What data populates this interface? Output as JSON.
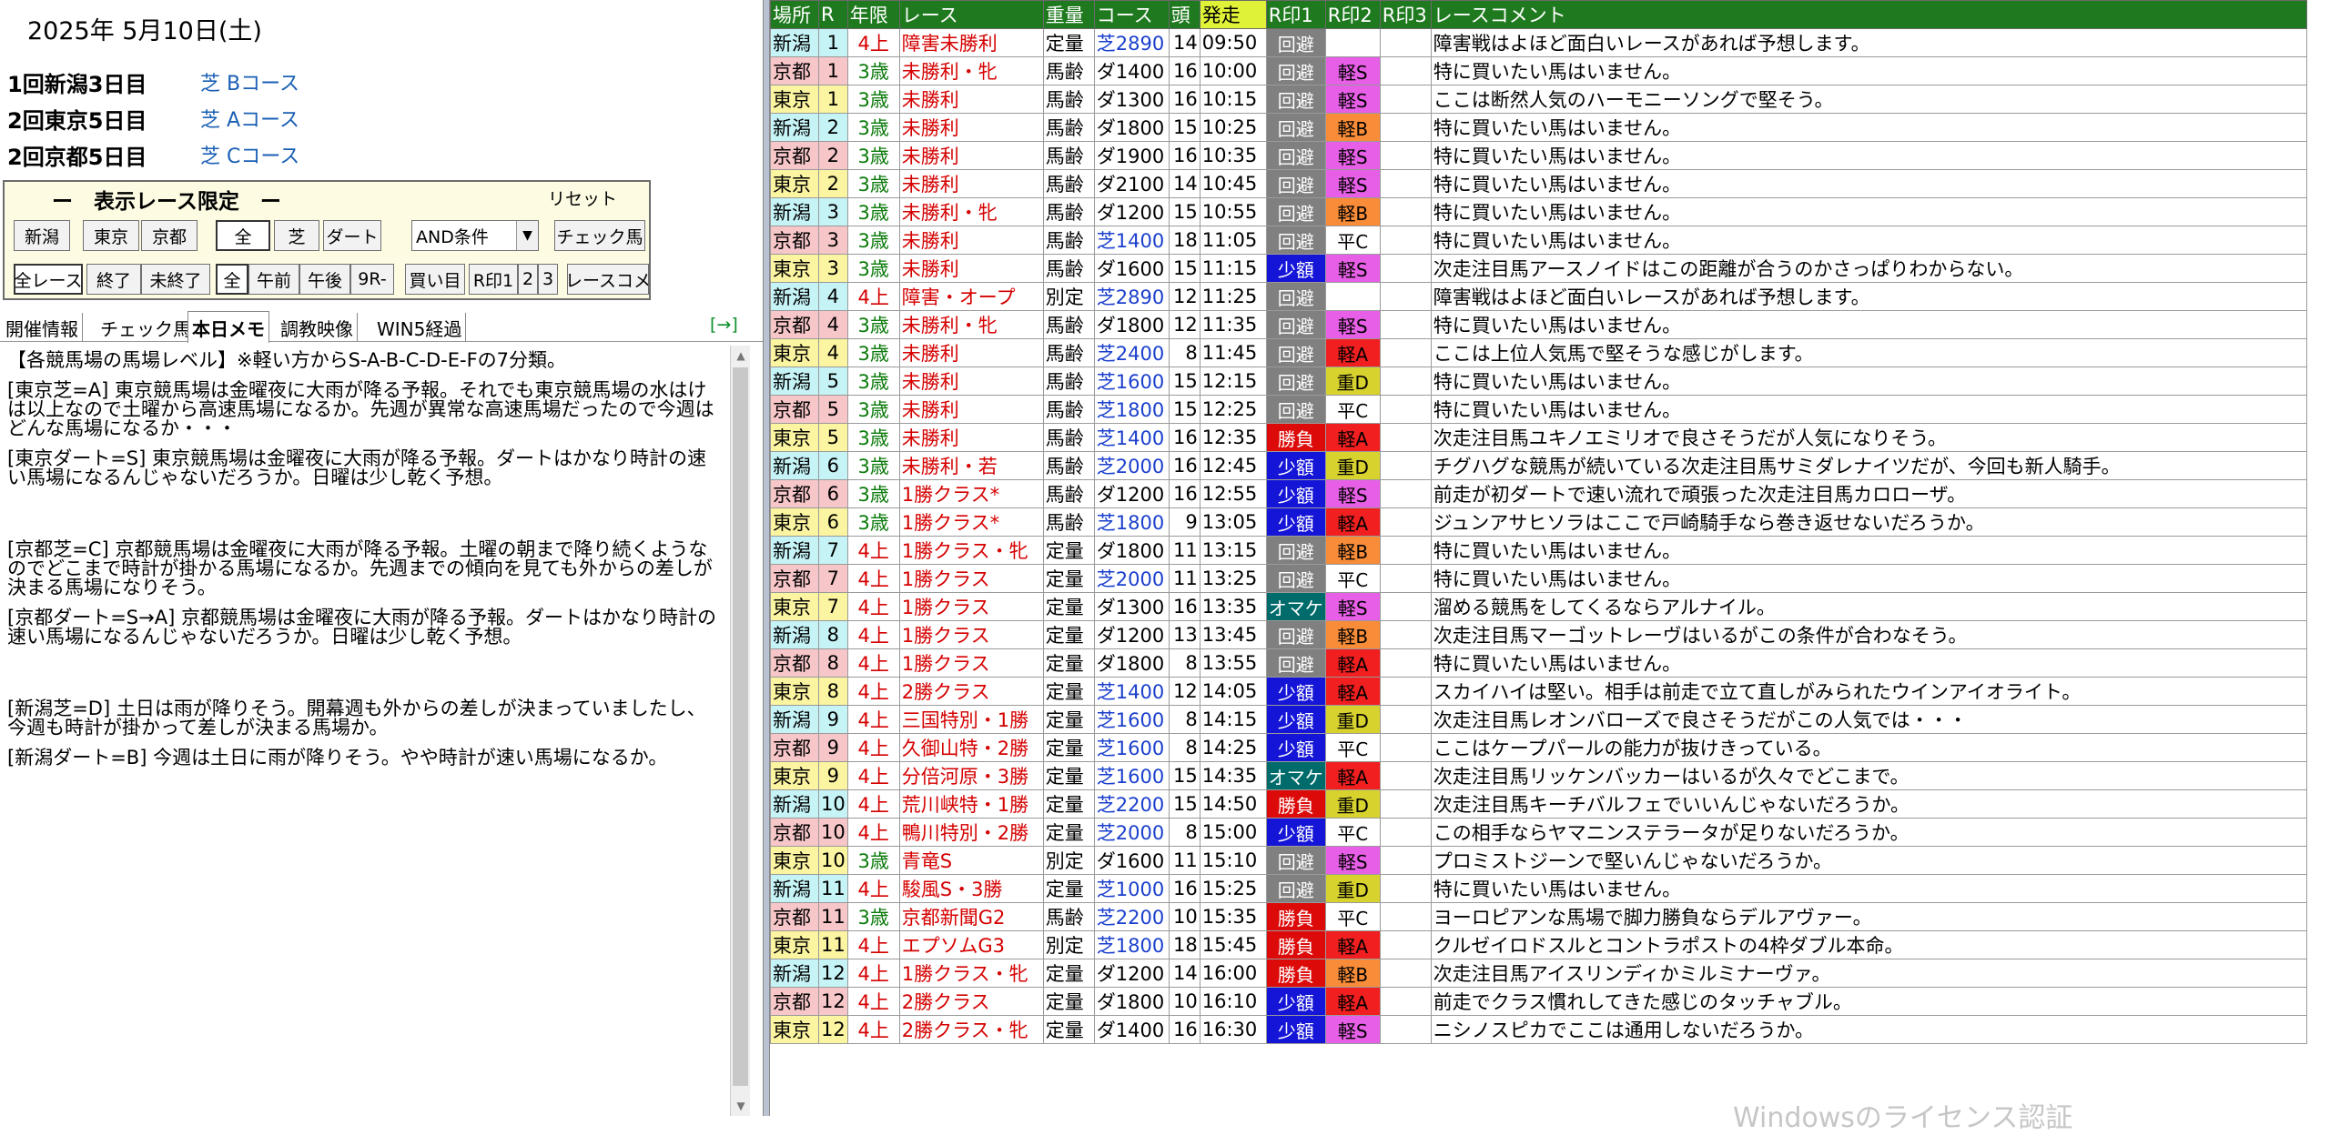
{
  "left": {
    "date": "2025年 5月10日(土)",
    "meets": [
      {
        "name": "1回新潟3日目",
        "course": "芝 Bコース"
      },
      {
        "name": "2回東京5日目",
        "course": "芝 Aコース"
      },
      {
        "name": "2回京都5日目",
        "course": "芝 Cコース"
      }
    ],
    "filter": {
      "title": "ー　表示レース限定　ー",
      "reset": "リセット",
      "row1": [
        "新潟",
        "東京",
        "京都",
        "全",
        "芝",
        "ダート"
      ],
      "and_select": "AND条件",
      "check_horse": "チェック馬",
      "row2": [
        "全レース",
        "終了",
        "未終了",
        "全",
        "午前",
        "午後",
        "9R-",
        "買い目",
        "R印1",
        "2",
        "3",
        "レースコメ"
      ]
    },
    "tabs": [
      "開催情報",
      "チェック馬",
      "本日メモ",
      "調教映像",
      "WIN5経過"
    ],
    "tab_arrow": "[→]",
    "memo": [
      "【各競馬場の馬場レベル】※軽い方からS-A-B-C-D-E-Fの7分類。",
      "[東京芝=A] 東京競馬場は金曜夜に大雨が降る予報。それでも東京競馬場の水はけは以上なので土曜から高速馬場になるか。先週が異常な高速馬場だったので今週はどんな馬場になるか・・・",
      "[東京ダート=S] 東京競馬場は金曜夜に大雨が降る予報。ダートはかなり時計の速い馬場になるんじゃないだろうか。日曜は少し乾く予想。",
      "",
      "[京都芝=C] 京都競馬場は金曜夜に大雨が降る予報。土曜の朝まで降り続くようなのでどこまで時計が掛かる馬場になるか。先週までの傾向を見ても外からの差しが決まる馬場になりそう。",
      "[京都ダート=S→A] 京都競馬場は金曜夜に大雨が降る予報。ダートはかなり時計の速い馬場になるんじゃないだろうか。日曜は少し乾く予想。",
      "",
      "[新潟芝=D] 土日は雨が降りそう。開幕週も外からの差しが決まっていましたし、今週も時計が掛かって差しが決まる馬場か。",
      "[新潟ダート=B] 今週は土日に雨が降りそう。やや時計が速い馬場になるか。"
    ]
  },
  "grid": {
    "headers": [
      "場所",
      "R",
      "年限",
      "レース",
      "重量",
      "コース",
      "頭",
      "発走",
      "R印1",
      "R印2",
      "R印3",
      "レースコメント"
    ],
    "rows": [
      [
        "新潟",
        "1",
        "4上",
        "障害未勝利",
        "定量",
        "芝2890",
        "14",
        "09:50",
        "回避",
        "",
        "",
        "障害戦はよほど面白いレースがあれば予想します。"
      ],
      [
        "京都",
        "1",
        "3歳",
        "未勝利・牝",
        "馬齢",
        "ダ1400",
        "16",
        "10:00",
        "回避",
        "軽S",
        "",
        "特に買いたい馬はいません。"
      ],
      [
        "東京",
        "1",
        "3歳",
        "未勝利",
        "馬齢",
        "ダ1300",
        "16",
        "10:15",
        "回避",
        "軽S",
        "",
        "ここは断然人気のハーモニーソングで堅そう。"
      ],
      [
        "新潟",
        "2",
        "3歳",
        "未勝利",
        "馬齢",
        "ダ1800",
        "15",
        "10:25",
        "回避",
        "軽B",
        "",
        "特に買いたい馬はいません。"
      ],
      [
        "京都",
        "2",
        "3歳",
        "未勝利",
        "馬齢",
        "ダ1900",
        "16",
        "10:35",
        "回避",
        "軽S",
        "",
        "特に買いたい馬はいません。"
      ],
      [
        "東京",
        "2",
        "3歳",
        "未勝利",
        "馬齢",
        "ダ2100",
        "14",
        "10:45",
        "回避",
        "軽S",
        "",
        "特に買いたい馬はいません。"
      ],
      [
        "新潟",
        "3",
        "3歳",
        "未勝利・牝",
        "馬齢",
        "ダ1200",
        "15",
        "10:55",
        "回避",
        "軽B",
        "",
        "特に買いたい馬はいません。"
      ],
      [
        "京都",
        "3",
        "3歳",
        "未勝利",
        "馬齢",
        "芝1400",
        "18",
        "11:05",
        "回避",
        "平C",
        "",
        "特に買いたい馬はいません。"
      ],
      [
        "東京",
        "3",
        "3歳",
        "未勝利",
        "馬齢",
        "ダ1600",
        "15",
        "11:15",
        "少額",
        "軽S",
        "",
        "次走注目馬アースノイドはこの距離が合うのかさっぱりわからない。"
      ],
      [
        "新潟",
        "4",
        "4上",
        "障害・オープ",
        "別定",
        "芝2890",
        "12",
        "11:25",
        "回避",
        "",
        "",
        "障害戦はよほど面白いレースがあれば予想します。"
      ],
      [
        "京都",
        "4",
        "3歳",
        "未勝利・牝",
        "馬齢",
        "ダ1800",
        "12",
        "11:35",
        "回避",
        "軽S",
        "",
        "特に買いたい馬はいません。"
      ],
      [
        "東京",
        "4",
        "3歳",
        "未勝利",
        "馬齢",
        "芝2400",
        "8",
        "11:45",
        "回避",
        "軽A",
        "",
        "ここは上位人気馬で堅そうな感じがします。"
      ],
      [
        "新潟",
        "5",
        "3歳",
        "未勝利",
        "馬齢",
        "芝1600",
        "15",
        "12:15",
        "回避",
        "重D",
        "",
        "特に買いたい馬はいません。"
      ],
      [
        "京都",
        "5",
        "3歳",
        "未勝利",
        "馬齢",
        "芝1800",
        "15",
        "12:25",
        "回避",
        "平C",
        "",
        "特に買いたい馬はいません。"
      ],
      [
        "東京",
        "5",
        "3歳",
        "未勝利",
        "馬齢",
        "芝1400",
        "16",
        "12:35",
        "勝負",
        "軽A",
        "",
        "次走注目馬ユキノエミリオで良さそうだが人気になりそう。"
      ],
      [
        "新潟",
        "6",
        "3歳",
        "未勝利・若",
        "馬齢",
        "芝2000",
        "16",
        "12:45",
        "少額",
        "重D",
        "",
        "チグハグな競馬が続いている次走注目馬サミダレナイツだが、今回も新人騎手。"
      ],
      [
        "京都",
        "6",
        "3歳",
        "1勝クラス*",
        "馬齢",
        "ダ1200",
        "16",
        "12:55",
        "少額",
        "軽S",
        "",
        "前走が初ダートで速い流れで頑張った次走注目馬カロローザ。"
      ],
      [
        "東京",
        "6",
        "3歳",
        "1勝クラス*",
        "馬齢",
        "芝1800",
        "9",
        "13:05",
        "少額",
        "軽A",
        "",
        "ジュンアサヒソラはここで戸崎騎手なら巻き返せないだろうか。"
      ],
      [
        "新潟",
        "7",
        "4上",
        "1勝クラス・牝",
        "定量",
        "ダ1800",
        "11",
        "13:15",
        "回避",
        "軽B",
        "",
        "特に買いたい馬はいません。"
      ],
      [
        "京都",
        "7",
        "4上",
        "1勝クラス",
        "定量",
        "芝2000",
        "11",
        "13:25",
        "回避",
        "平C",
        "",
        "特に買いたい馬はいません。"
      ],
      [
        "東京",
        "7",
        "4上",
        "1勝クラス",
        "定量",
        "ダ1300",
        "16",
        "13:35",
        "オマケ",
        "軽S",
        "",
        "溜める競馬をしてくるならアルナイル。"
      ],
      [
        "新潟",
        "8",
        "4上",
        "1勝クラス",
        "定量",
        "ダ1200",
        "13",
        "13:45",
        "回避",
        "軽B",
        "",
        "次走注目馬マーゴットレーヴはいるがこの条件が合わなそう。"
      ],
      [
        "京都",
        "8",
        "4上",
        "1勝クラス",
        "定量",
        "ダ1800",
        "8",
        "13:55",
        "回避",
        "軽A",
        "",
        "特に買いたい馬はいません。"
      ],
      [
        "東京",
        "8",
        "4上",
        "2勝クラス",
        "定量",
        "芝1400",
        "12",
        "14:05",
        "少額",
        "軽A",
        "",
        "スカイハイは堅い。相手は前走で立て直しがみられたウインアイオライト。"
      ],
      [
        "新潟",
        "9",
        "4上",
        "三国特別・1勝",
        "定量",
        "芝1600",
        "8",
        "14:15",
        "少額",
        "重D",
        "",
        "次走注目馬レオンバローズで良さそうだがこの人気では・・・"
      ],
      [
        "京都",
        "9",
        "4上",
        "久御山特・2勝",
        "定量",
        "芝1600",
        "8",
        "14:25",
        "少額",
        "平C",
        "",
        "ここはケープパールの能力が抜けきっている。"
      ],
      [
        "東京",
        "9",
        "4上",
        "分倍河原・3勝",
        "定量",
        "芝1600",
        "15",
        "14:35",
        "オマケ",
        "軽A",
        "",
        "次走注目馬リッケンバッカーはいるが久々でどこまで。"
      ],
      [
        "新潟",
        "10",
        "4上",
        "荒川峡特・1勝",
        "定量",
        "芝2200",
        "15",
        "14:50",
        "勝負",
        "重D",
        "",
        "次走注目馬キーチバルフェでいいんじゃないだろうか。"
      ],
      [
        "京都",
        "10",
        "4上",
        "鴨川特別・2勝",
        "定量",
        "芝2000",
        "8",
        "15:00",
        "少額",
        "平C",
        "",
        "この相手ならヤマニンステラータが足りないだろうか。"
      ],
      [
        "東京",
        "10",
        "3歳",
        "青竜S",
        "別定",
        "ダ1600",
        "11",
        "15:10",
        "回避",
        "軽S",
        "",
        "プロミストジーンで堅いんじゃないだろうか。"
      ],
      [
        "新潟",
        "11",
        "4上",
        "駿風S・3勝",
        "定量",
        "芝1000",
        "16",
        "15:25",
        "回避",
        "重D",
        "",
        "特に買いたい馬はいません。"
      ],
      [
        "京都",
        "11",
        "3歳",
        "京都新聞G2",
        "馬齢",
        "芝2200",
        "10",
        "15:35",
        "勝負",
        "平C",
        "",
        "ヨーロピアンな馬場で脚力勝負ならデルアヴァー。"
      ],
      [
        "東京",
        "11",
        "4上",
        "エプソムG3",
        "別定",
        "芝1800",
        "18",
        "15:45",
        "勝負",
        "軽A",
        "",
        "クルゼイロドスルとコントラポストの4枠ダブル本命。"
      ],
      [
        "新潟",
        "12",
        "4上",
        "1勝クラス・牝",
        "定量",
        "ダ1200",
        "14",
        "16:00",
        "勝負",
        "軽B",
        "",
        "次走注目馬アイスリンディかミルミナーヴァ。"
      ],
      [
        "京都",
        "12",
        "4上",
        "2勝クラス",
        "定量",
        "ダ1800",
        "10",
        "16:10",
        "少額",
        "軽A",
        "",
        "前走でクラス慣れしてきた感じのタッチャブル。"
      ],
      [
        "東京",
        "12",
        "4上",
        "2勝クラス・牝",
        "定量",
        "ダ1400",
        "16",
        "16:30",
        "少額",
        "軽S",
        "",
        "ニシノスピカでここは通用しないだろうか。"
      ]
    ]
  },
  "colors": {
    "venue": {
      "新潟": "#c6f3f6",
      "京都": "#f7c6c9",
      "東京": "#fbf4a0"
    },
    "age": {
      "3歳": "#0a7a0a",
      "4上": "#d50000"
    },
    "surface": {
      "芝": "#1a3fcc",
      "ダ": "#000000"
    },
    "mark1": {
      "回避": {
        "bg": "#808080",
        "fg": "#ffffff"
      },
      "少額": {
        "bg": "#1515d8",
        "fg": "#ffffff"
      },
      "勝負": {
        "bg": "#dd0a0a",
        "fg": "#ffffff"
      },
      "オマケ": {
        "bg": "#006b6b",
        "fg": "#ffffff"
      }
    },
    "mark2": {
      "軽S": "#e65fe6",
      "軽A": "#f11f1f",
      "軽B": "#f88c38",
      "平C": "#ffffff",
      "重D": "#d7d22e"
    }
  },
  "watermark": "Windowsのライセンス認証"
}
